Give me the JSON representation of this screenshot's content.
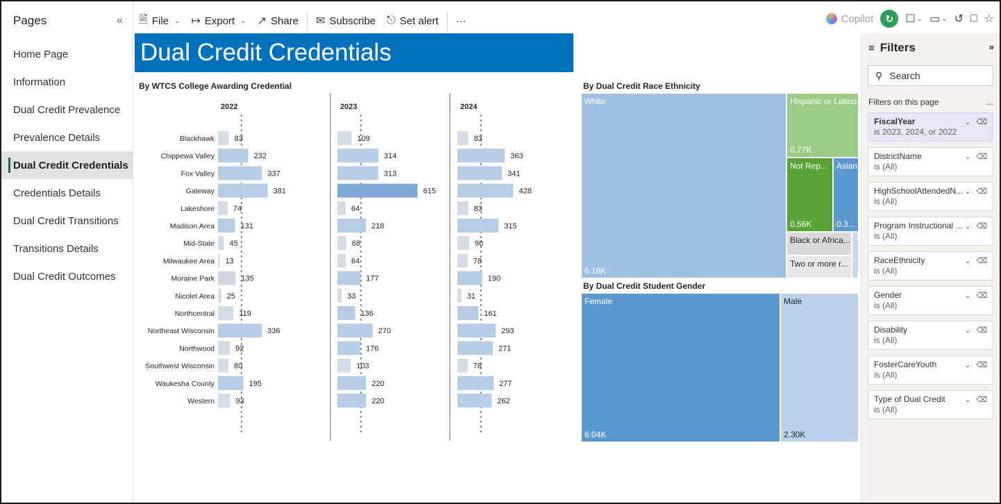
{
  "toolbar": {
    "file": "File",
    "export": "Export",
    "share": "Share",
    "subscribe": "Subscribe",
    "set_alert": "Set alert",
    "more": "···",
    "copilot": "Copilot"
  },
  "pages": {
    "title": "Pages",
    "collapse": "«",
    "items": [
      {
        "label": "Home Page",
        "active": false
      },
      {
        "label": "Information",
        "active": false
      },
      {
        "label": "Dual Credit Prevalence",
        "active": false
      },
      {
        "label": "Prevalence Details",
        "active": false
      },
      {
        "label": "Dual Credit Credentials",
        "active": true
      },
      {
        "label": "Credentials Details",
        "active": false
      },
      {
        "label": "Dual Credit Transitions",
        "active": false
      },
      {
        "label": "Transitions Details",
        "active": false
      },
      {
        "label": "Dual Credit Outcomes",
        "active": false
      }
    ]
  },
  "report": {
    "title": "Dual Credit Credentials",
    "bar_title": "By WTCS College Awarding Credential",
    "race_title": "By Dual Credit Race Ethnicity",
    "gender_title": "By Dual Credit Student Gender"
  },
  "chart_data": [
    {
      "type": "bar",
      "title": "By WTCS College Awarding Credential",
      "categories": [
        "Blackhawk",
        "Chippewa Valley",
        "Fox Valley",
        "Gateway",
        "Lakeshore",
        "Madison Area",
        "Mid-State",
        "Milwaukee Area",
        "Moraine Park",
        "Nicolet Area",
        "Northcentral",
        "Northeast Wisconsin",
        "Northwood",
        "Southwest Wisconsin",
        "Waukesha County",
        "Western"
      ],
      "series": [
        {
          "name": "2022",
          "values": [
            83,
            232,
            337,
            381,
            74,
            131,
            45,
            13,
            135,
            25,
            119,
            336,
            92,
            80,
            195,
            93
          ]
        },
        {
          "name": "2023",
          "values": [
            109,
            314,
            313,
            615,
            64,
            218,
            68,
            64,
            177,
            33,
            136,
            270,
            176,
            103,
            220,
            220
          ]
        },
        {
          "name": "2024",
          "values": [
            83,
            363,
            341,
            428,
            83,
            315,
            90,
            78,
            190,
            31,
            161,
            293,
            271,
            78,
            277,
            262
          ]
        }
      ]
    },
    {
      "type": "treemap",
      "title": "By Dual Credit Race Ethnicity",
      "items": [
        {
          "label": "White",
          "value_label": "6.18K"
        },
        {
          "label": "Hispanic or Latino",
          "value_label": "0.77K"
        },
        {
          "label": "Not Rep...",
          "value_label": "0.56K"
        },
        {
          "label": "Asian",
          "value_label": "0.3..."
        },
        {
          "label": "Black or Africa...",
          "value_label": ""
        },
        {
          "label": "Two or more r...",
          "value_label": ""
        }
      ]
    },
    {
      "type": "treemap",
      "title": "By Dual Credit Student Gender",
      "items": [
        {
          "label": "Female",
          "value_label": "6.04K"
        },
        {
          "label": "Male",
          "value_label": "2.30K"
        }
      ]
    }
  ],
  "filters": {
    "title": "Filters",
    "expand": "»",
    "search_placeholder": "Search",
    "on_page_label": "Filters on this page",
    "on_page_more": "...",
    "items": [
      {
        "name": "FiscalYear",
        "value": "is 2023, 2024, or 2022",
        "highlight": true
      },
      {
        "name": "DistrictName",
        "value": "is (All)",
        "highlight": false
      },
      {
        "name": "HighSchoolAttendedN...",
        "value": "is (All)",
        "highlight": false
      },
      {
        "name": "Program Instructional ...",
        "value": "is (All)",
        "highlight": false
      },
      {
        "name": "RaceEthnicity",
        "value": "is (All)",
        "highlight": false
      },
      {
        "name": "Gender",
        "value": "is (All)",
        "highlight": false
      },
      {
        "name": "Disability",
        "value": "is (All)",
        "highlight": false
      },
      {
        "name": "FosterCareYouth",
        "value": "is (All)",
        "highlight": false
      },
      {
        "name": "Type of Dual Credit",
        "value": "is (All)",
        "highlight": false
      }
    ]
  },
  "colors": {
    "banner": "#0071bc",
    "white_cell": "#a0c0e3",
    "hispanic_cell": "#9ccb86",
    "notrep_cell": "#58a237",
    "asian_cell": "#5b97d0",
    "black_cell": "#d9d9d9",
    "twoormore_cell": "#e7e7e7",
    "female_cell": "#5b97d0",
    "male_cell": "#b9d2ea",
    "active_page_accent": "#0c6b3f"
  }
}
